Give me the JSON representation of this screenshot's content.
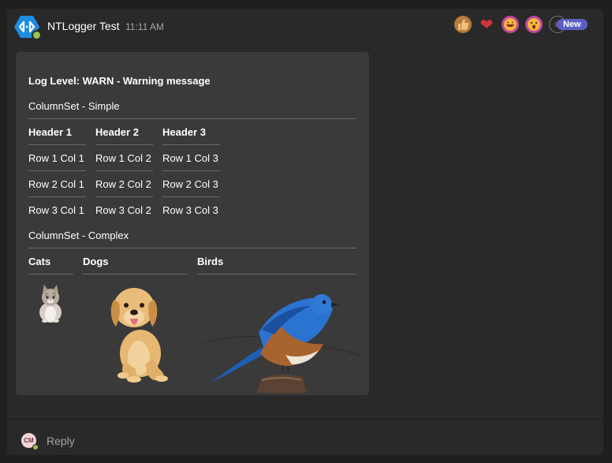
{
  "message": {
    "sender": "NTLogger Test",
    "time": "11:11 AM",
    "new_badge": "New",
    "reactions": [
      "like-icon",
      "heart-icon",
      "laugh-icon",
      "surprised-icon",
      "add-reaction-icon"
    ]
  },
  "card": {
    "title": "Log Level: WARN - Warning message",
    "simple_label": "ColumnSet - Simple",
    "simple_headers": [
      "Header 1",
      "Header 2",
      "Header 3"
    ],
    "simple_rows": [
      [
        "Row 1 Col 1",
        "Row 1 Col 2",
        "Row 1 Col 3"
      ],
      [
        "Row 2 Col 1",
        "Row 2 Col 2",
        "Row 2 Col 3"
      ],
      [
        "Row 3 Col 1",
        "Row 3 Col 2",
        "Row 3 Col 3"
      ]
    ],
    "complex_label": "ColumnSet - Complex",
    "complex_headers": [
      "Cats",
      "Dogs",
      "Birds"
    ]
  },
  "reply": {
    "avatar_initials": "CM",
    "label": "Reply"
  },
  "colors": {
    "accent": "#5b5fc7",
    "presence": "#92c353"
  }
}
